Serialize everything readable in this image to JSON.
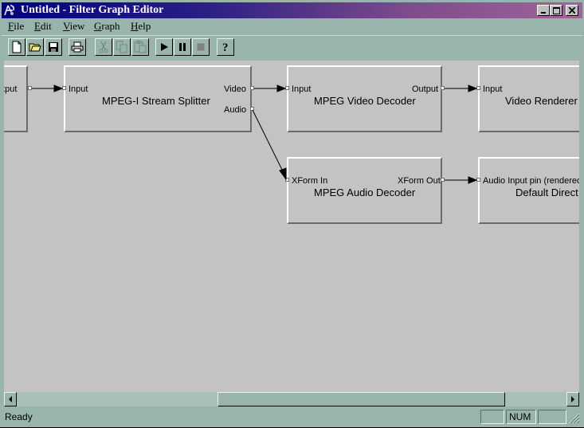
{
  "window": {
    "title": "Untitled - Filter Graph Editor",
    "controls": [
      "minimize-icon",
      "maximize-icon",
      "close-icon"
    ]
  },
  "menu": {
    "items": [
      {
        "label": "File",
        "accel": "F"
      },
      {
        "label": "Edit",
        "accel": "E"
      },
      {
        "label": "View",
        "accel": "V"
      },
      {
        "label": "Graph",
        "accel": "G"
      },
      {
        "label": "Help",
        "accel": "H"
      }
    ]
  },
  "toolbar": {
    "buttons": [
      {
        "icon": "new-file-icon",
        "enabled": true
      },
      {
        "icon": "open-folder-icon",
        "enabled": true
      },
      {
        "icon": "save-disk-icon",
        "enabled": true
      },
      {
        "icon": "print-icon",
        "enabled": true
      },
      {
        "icon": "cut-icon",
        "enabled": false
      },
      {
        "icon": "copy-icon",
        "enabled": false
      },
      {
        "icon": "paste-icon",
        "enabled": false
      },
      {
        "icon": "play-icon",
        "enabled": true
      },
      {
        "icon": "pause-icon",
        "enabled": true
      },
      {
        "icon": "stop-icon",
        "enabled": true
      },
      {
        "icon": "help-context-icon",
        "enabled": true
      }
    ]
  },
  "graph": {
    "filters": [
      {
        "name": "",
        "output_pin": "utput"
      },
      {
        "name": "MPEG-I Stream Splitter",
        "input_pin": "Input",
        "output_pins": [
          "Video",
          "Audio"
        ]
      },
      {
        "name": "MPEG Video Decoder",
        "input_pin": "Input",
        "output_pin": "Output"
      },
      {
        "name": "Video Renderer",
        "input_pin": "Input"
      },
      {
        "name": "MPEG Audio Decoder",
        "input_pin": "XForm In",
        "output_pin": "XForm Out"
      },
      {
        "name": "Default Direct",
        "input_pin": "Audio Input pin (rendered"
      }
    ]
  },
  "statusbar": {
    "text": "Ready",
    "panes": [
      "",
      "NUM",
      ""
    ]
  }
}
